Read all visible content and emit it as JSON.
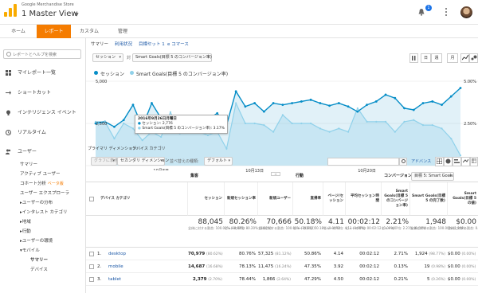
{
  "header": {
    "org": "Google Merchandise Store",
    "view": "1 Master View",
    "notification_count": "1"
  },
  "tabs": [
    {
      "label": "ホーム"
    },
    {
      "label": "レポート"
    },
    {
      "label": "カスタム"
    },
    {
      "label": "管理"
    }
  ],
  "sidebar": {
    "search_placeholder": "レポートとヘルプを検索",
    "items": [
      {
        "label": "マイレポート一覧",
        "icon": "grid-icon"
      },
      {
        "label": "ショートカット",
        "icon": "arrow-icon"
      },
      {
        "label": "インテリジェンス イベント",
        "icon": "bulb-icon"
      },
      {
        "label": "リアルタイム",
        "icon": "clock-icon"
      },
      {
        "label": "ユーザー",
        "icon": "users-icon"
      }
    ],
    "sub": [
      {
        "label": "サマリー"
      },
      {
        "label": "アクティブ ユーザー"
      },
      {
        "label": "コホート分析",
        "badge": "ベータ版"
      },
      {
        "label": "ユーザー エクスプローラ"
      },
      {
        "label": "▸ユーザーの分布"
      },
      {
        "label": "▸インタレスト カテゴリ"
      },
      {
        "label": "▸地域"
      },
      {
        "label": "▸行動"
      },
      {
        "label": "▸ユーザーの環境"
      },
      {
        "label": "▾モバイル"
      },
      {
        "label": "サマリー"
      },
      {
        "label": "デバイス"
      }
    ]
  },
  "subnav": {
    "summary": "サマリー",
    "usage": "利用状況",
    "goal_set": "目標セット 1",
    "ecommerce": "e コマース"
  },
  "controls": {
    "metric1": "セッション",
    "vs": "対",
    "metric2": "Smart Goals(目標 5 のコンバージョン率)",
    "period_day": "日",
    "period_week": "週",
    "period_month": "月"
  },
  "legend": {
    "series1": "セッション",
    "series2": "Smart Goals(目標 5 のコンバージョン率)"
  },
  "chart_data": {
    "type": "line",
    "x_ticks": [
      "10月8日",
      "10月13日",
      "10月20日"
    ],
    "y_left_ticks": [
      "5,000",
      "2,500"
    ],
    "y_right_ticks": [
      "5.00%",
      "2.50%"
    ],
    "series": [
      {
        "name": "セッション",
        "color": "#058dc7",
        "values": [
          2500,
          2600,
          2300,
          2700,
          3600,
          2300,
          3700,
          2800,
          2776,
          2900,
          2700,
          2600,
          2750,
          3100,
          2400,
          4400,
          3500,
          3700,
          3200,
          3700,
          3600,
          3700,
          3800,
          3900,
          3700,
          3550,
          3700,
          3500,
          3200,
          3600,
          3800,
          4200,
          4000,
          3400,
          3300,
          3700,
          3800,
          3600,
          4100,
          4600
        ]
      },
      {
        "name": "Smart Goals(目標 5 のコンバージョン率)",
        "color": "#90d1ea",
        "values": [
          2.6,
          2.6,
          1.6,
          2.5,
          2.2,
          1.5,
          2.0,
          1.7,
          3.17,
          1.9,
          2.3,
          2.0,
          1.8,
          2.0,
          1.0,
          3.7,
          2.5,
          2.5,
          2.4,
          2.0,
          3.0,
          2.5,
          2.5,
          2.5,
          2.2,
          2.0,
          2.2,
          2.0,
          3.4,
          2.6,
          2.6,
          2.6,
          2.0,
          2.6,
          2.7,
          2.4,
          2.4,
          2.2,
          1.6,
          0.6
        ]
      }
    ]
  },
  "tooltip": {
    "date": "2016年9月26日月曜日",
    "line1": "セッション: 2,776",
    "line2": "Smart Goals(目標 5 のコンバージョン率): 3.17%"
  },
  "primary_dimension": {
    "label": "プライマリ ディメンション:",
    "value": "デバイス カテゴリ"
  },
  "table_controls": {
    "plot_rows": "グラフに表示",
    "secondary_dim": "セカンダリ ディメンション",
    "sort_type_label": "並べ替えの種類:",
    "sort_type_value": "デフォルト",
    "advanced": "アドバンス"
  },
  "table": {
    "group_acquisition": "集客",
    "group_behavior": "行動",
    "group_conversion": "コンバージョン",
    "goal_select": "目標 5: Smart Goals",
    "dim_header": "デバイス カテゴリ",
    "columns": [
      "セッション",
      "新規セッション率",
      "新規ユーザー",
      "直帰率",
      "ページ/セッション",
      "平均セッション時間",
      "Smart Goals(目標 5 のコンバージョン率)",
      "Smart Goals(目標 5 の完了数)",
      "Smart Goals(目標 5 の値)"
    ],
    "totals": [
      {
        "big": "88,045",
        "small": "全体に対する割合: 100.00% (88,045)"
      },
      {
        "big": "80.26%",
        "small": "ビューの平均: 80.20% (0.08%)"
      },
      {
        "big": "70,666",
        "small": "全体に対する割合: 100.08% (70,612)"
      },
      {
        "big": "50.18%",
        "small": "ビューの平均: 50.18% (0.00%)"
      },
      {
        "big": "4.11",
        "small": "ビューの平均: 4.11 (0.00%)"
      },
      {
        "big": "00:02:12",
        "small": "ビューの平均: 00:02:12 (0.00%)"
      },
      {
        "big": "2.21%",
        "small": "ビューの平均: 2.21% (0.00%)"
      },
      {
        "big": "1,948",
        "small": "全体に対する割合: 100.00% (1,948)"
      },
      {
        "big": "$0.00",
        "small": "全体に対する割合: 0.00% ($0.00)"
      }
    ],
    "rows": [
      {
        "idx": "1.",
        "name": "desktop",
        "c": [
          "70,979",
          "(80.62%)",
          "80.76%",
          "57,325",
          "(81.12%)",
          "50.86%",
          "4.14",
          "00:02:12",
          "2.71%",
          "1,924",
          "(98.77%)",
          "$0.00",
          "(0.00%)"
        ]
      },
      {
        "idx": "2.",
        "name": "mobile",
        "c": [
          "14,687",
          "(16.68%)",
          "78.13%",
          "11,475",
          "(16.24%)",
          "47.35%",
          "3.92",
          "00:02:12",
          "0.13%",
          "19",
          "(0.98%)",
          "$0.00",
          "(0.00%)"
        ]
      },
      {
        "idx": "3.",
        "name": "tablet",
        "c": [
          "2,379",
          "(2.70%)",
          "78.44%",
          "1,866",
          "(2.64%)",
          "47.29%",
          "4.50",
          "00:02:12",
          "0.21%",
          "5",
          "(0.26%)",
          "$0.00",
          "(0.00%)"
        ]
      }
    ]
  }
}
